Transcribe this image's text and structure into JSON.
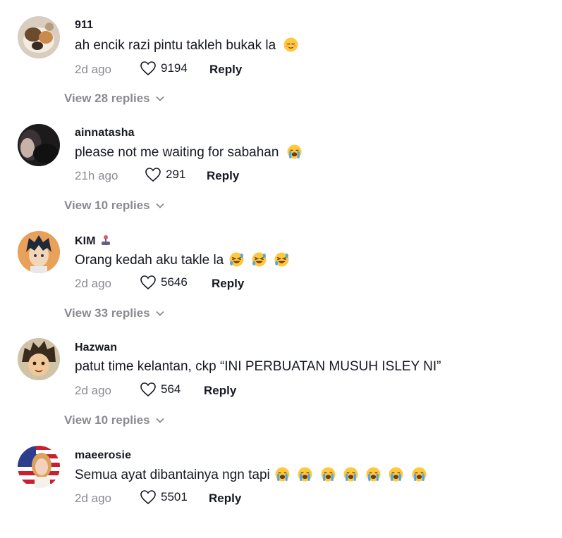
{
  "comments": [
    {
      "username": "911",
      "text": "ah encik razi pintu takleh bukak la",
      "emojis": [
        "relieved-face"
      ],
      "time": "2d ago",
      "likes": "9194",
      "reply_label": "Reply",
      "view_replies": "View 28 replies",
      "avatar": "cat-photo"
    },
    {
      "username": "ainnatasha",
      "text": "please not me waiting for sabahan",
      "emojis": [
        "crying-face"
      ],
      "time": "21h ago",
      "likes": "291",
      "reply_label": "Reply",
      "view_replies": "View 10 replies",
      "avatar": "dark-photo"
    },
    {
      "username": "KIM",
      "badge": "joystick-icon",
      "text": "Orang kedah aku takle la",
      "emojis": [
        "rofl-face",
        "rofl-face",
        "rofl-face"
      ],
      "time": "2d ago",
      "likes": "5646",
      "reply_label": "Reply",
      "view_replies": "View 33 replies",
      "avatar": "anime-boy"
    },
    {
      "username": "Hazwan",
      "text": "patut time kelantan, ckp “INI PERBUATAN MUSUH ISLEY NI”",
      "emojis": [],
      "time": "2d ago",
      "likes": "564",
      "reply_label": "Reply",
      "view_replies": "View 10 replies",
      "avatar": "spiky-hair-boy"
    },
    {
      "username": "maeerosie",
      "text": "Semua ayat dibantainya ngn tapi",
      "emojis": [
        "crying-face",
        "crying-face",
        "crying-face",
        "crying-face",
        "crying-face",
        "crying-face",
        "crying-face"
      ],
      "time": "2d ago",
      "likes": "5501",
      "reply_label": "Reply",
      "avatar": "flag-woman"
    }
  ],
  "colors": {
    "text": "#161823",
    "muted": "#8a8b91",
    "emoji_yellow": "#ffc83d",
    "tear_blue": "#4fa8e8"
  }
}
